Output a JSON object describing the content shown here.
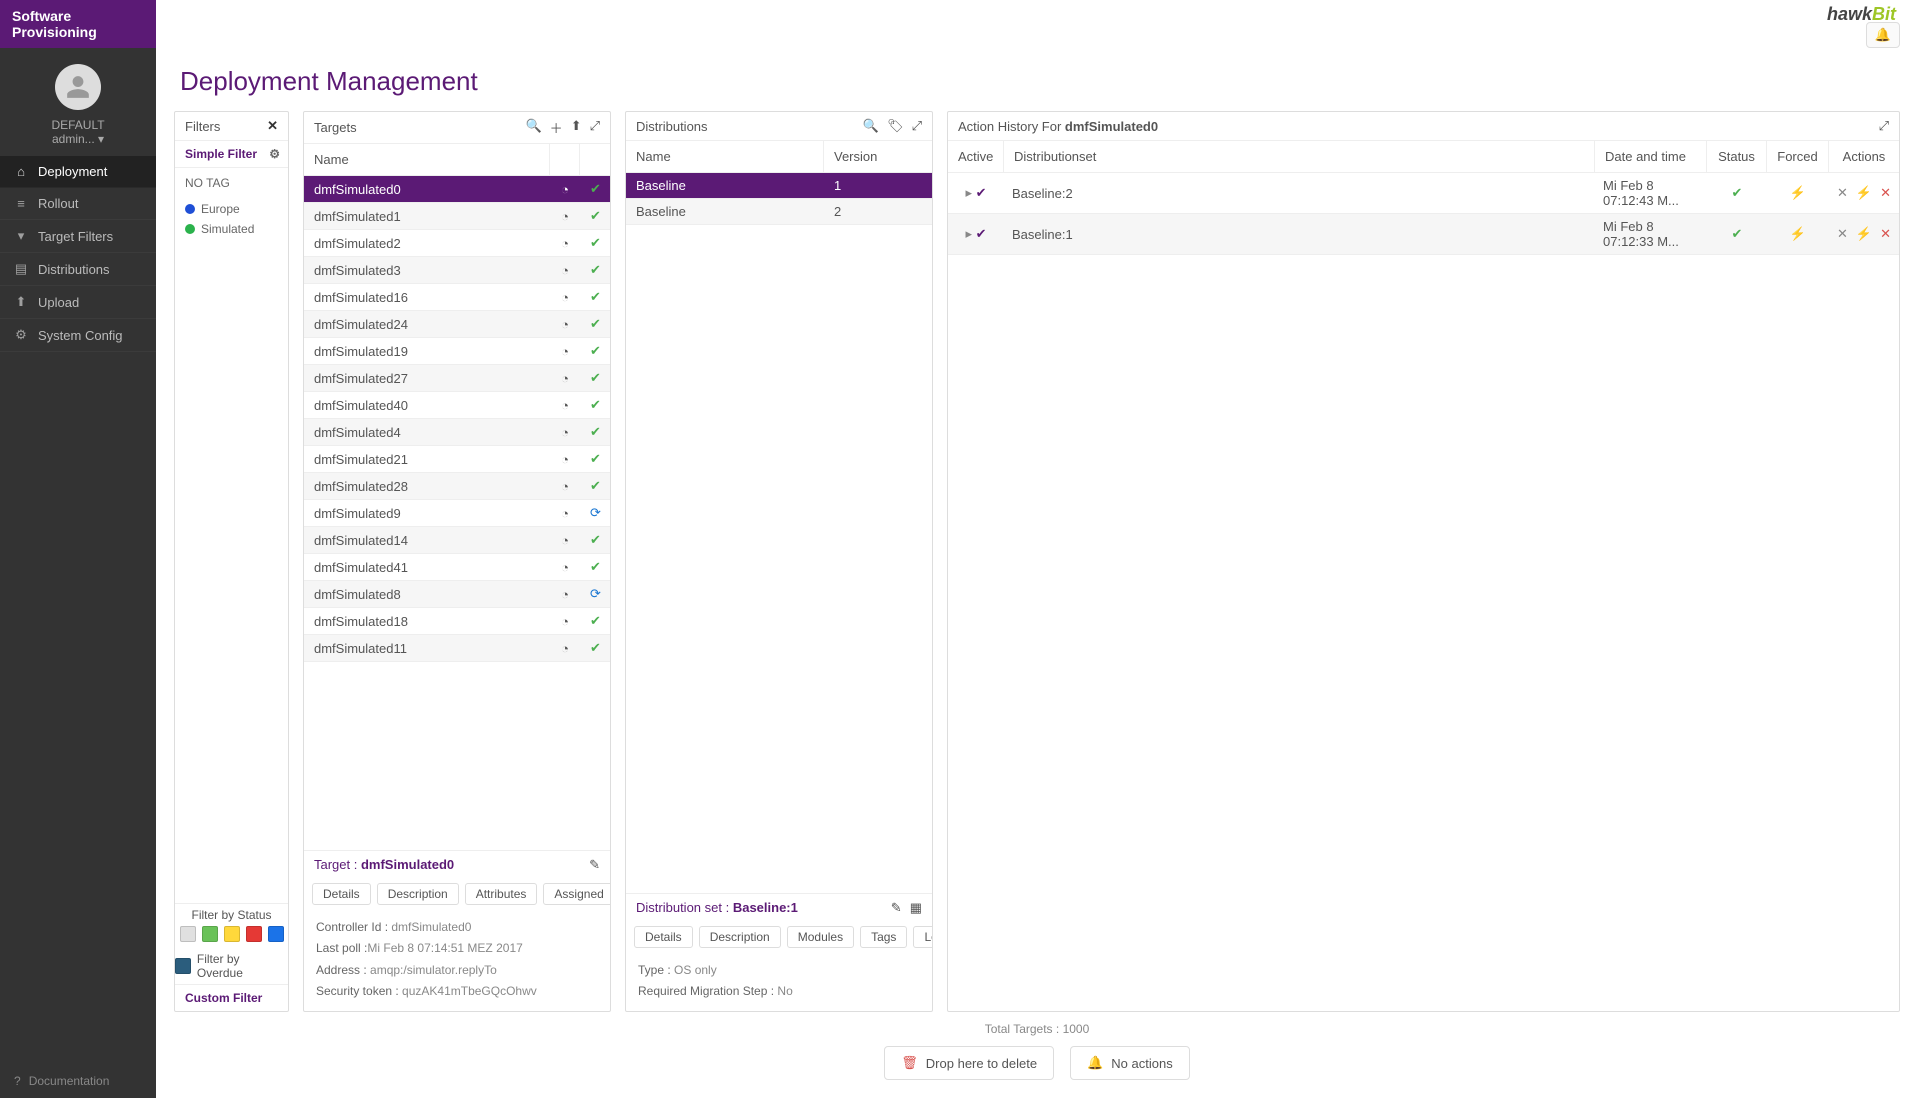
{
  "appName": "Software Provisioning",
  "logo": {
    "part1": "hawk",
    "part2": "Bit"
  },
  "user": {
    "tenant": "DEFAULT",
    "name": "admin..."
  },
  "nav": [
    {
      "icon": "home",
      "label": "Deployment",
      "active": true
    },
    {
      "icon": "list",
      "label": "Rollout"
    },
    {
      "icon": "filter",
      "label": "Target Filters"
    },
    {
      "icon": "archive",
      "label": "Distributions"
    },
    {
      "icon": "upload",
      "label": "Upload"
    },
    {
      "icon": "gear",
      "label": "System Config"
    }
  ],
  "navFooter": {
    "icon": "help",
    "label": "Documentation"
  },
  "pageTitle": "Deployment Management",
  "filters": {
    "title": "Filters",
    "simpleTitle": "Simple Filter",
    "noTag": "NO TAG",
    "tags": [
      {
        "color": "#1f4fd6",
        "label": "Europe"
      },
      {
        "color": "#2bb24c",
        "label": "Simulated"
      }
    ],
    "statusTitle": "Filter by Status",
    "swatches": [
      "#e0e0e0",
      "#6ac259",
      "#ffd83b",
      "#e53935",
      "#1b73e8"
    ],
    "overdueLabel": "Filter by Overdue",
    "customTitle": "Custom Filter"
  },
  "targets": {
    "title": "Targets",
    "header": "Name",
    "rows": [
      {
        "name": "dmfSimulated0",
        "s1": "clock",
        "s2": "ok",
        "selected": true
      },
      {
        "name": "dmfSimulated1",
        "s1": "clock",
        "s2": "ok"
      },
      {
        "name": "dmfSimulated2",
        "s1": "clock",
        "s2": "ok"
      },
      {
        "name": "dmfSimulated3",
        "s1": "clock",
        "s2": "ok"
      },
      {
        "name": "dmfSimulated16",
        "s1": "clock",
        "s2": "ok"
      },
      {
        "name": "dmfSimulated24",
        "s1": "clock",
        "s2": "ok"
      },
      {
        "name": "dmfSimulated19",
        "s1": "clock",
        "s2": "ok"
      },
      {
        "name": "dmfSimulated27",
        "s1": "clock",
        "s2": "ok"
      },
      {
        "name": "dmfSimulated40",
        "s1": "clock",
        "s2": "ok"
      },
      {
        "name": "dmfSimulated4",
        "s1": "clock",
        "s2": "ok"
      },
      {
        "name": "dmfSimulated21",
        "s1": "clock",
        "s2": "ok"
      },
      {
        "name": "dmfSimulated28",
        "s1": "clock",
        "s2": "ok"
      },
      {
        "name": "dmfSimulated9",
        "s1": "clock",
        "s2": "sync"
      },
      {
        "name": "dmfSimulated14",
        "s1": "clock",
        "s2": "ok"
      },
      {
        "name": "dmfSimulated41",
        "s1": "clock",
        "s2": "ok"
      },
      {
        "name": "dmfSimulated8",
        "s1": "clock",
        "s2": "sync"
      },
      {
        "name": "dmfSimulated18",
        "s1": "clock",
        "s2": "ok"
      },
      {
        "name": "dmfSimulated11",
        "s1": "clock",
        "s2": "ok"
      }
    ]
  },
  "targetDetails": {
    "titlePrefix": "Target : ",
    "titleValue": "dmfSimulated0",
    "tabs": [
      "Details",
      "Description",
      "Attributes",
      "Assigned"
    ],
    "fields": {
      "controllerId": {
        "k": "Controller Id : ",
        "v": "dmfSimulated0"
      },
      "lastPoll": {
        "k": "Last poll :",
        "v": "Mi Feb 8 07:14:51 MEZ 2017"
      },
      "address": {
        "k": "Address : ",
        "v": "amqp:/simulator.replyTo"
      },
      "token": {
        "k": "Security token : ",
        "v": "quzAK41mTbeGQcOhwv"
      }
    }
  },
  "distributions": {
    "title": "Distributions",
    "headers": {
      "name": "Name",
      "version": "Version"
    },
    "rows": [
      {
        "name": "Baseline",
        "version": "1",
        "selected": true
      },
      {
        "name": "Baseline",
        "version": "2"
      }
    ]
  },
  "distDetails": {
    "titlePrefix": "Distribution set : ",
    "titleValue": "Baseline:1",
    "tabs": [
      "Details",
      "Description",
      "Modules",
      "Tags",
      "Log"
    ],
    "fields": {
      "type": {
        "k": "Type : ",
        "v": "OS only"
      },
      "migration": {
        "k": "Required Migration Step : ",
        "v": "No"
      }
    }
  },
  "history": {
    "titlePrefix": "Action History For ",
    "titleValue": "dmfSimulated0",
    "headers": {
      "active": "Active",
      "ds": "Distributionset",
      "dt": "Date and time",
      "status": "Status",
      "forced": "Forced",
      "actions": "Actions"
    },
    "rows": [
      {
        "active": "check",
        "ds": "Baseline:2",
        "dt": "Mi Feb 8 07:12:43 M...",
        "status": "ok",
        "forced": "bolt"
      },
      {
        "active": "check",
        "ds": "Baseline:1",
        "dt": "Mi Feb 8 07:12:33 M...",
        "status": "ok",
        "forced": "bolt"
      }
    ]
  },
  "footer": {
    "totalPrefix": "Total Targets : ",
    "totalValue": "1000",
    "dropDelete": "Drop here to delete",
    "noActions": "No actions"
  }
}
